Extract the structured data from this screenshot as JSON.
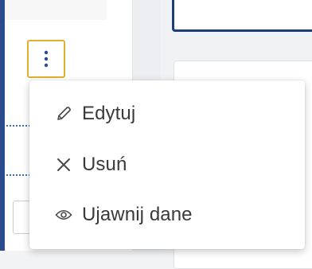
{
  "menu": {
    "items": [
      {
        "label": "Edytuj",
        "icon": "pencil-icon"
      },
      {
        "label": "Usuń",
        "icon": "close-icon"
      },
      {
        "label": "Ujawnij dane",
        "icon": "eye-icon"
      }
    ]
  },
  "more_button": {
    "icon": "kebab-vertical-icon"
  },
  "colors": {
    "focus_outline": "#e2b02c",
    "frame_border": "#2b4c8c",
    "menu_text": "#3a3a3a",
    "icon": "#4a4a4a"
  }
}
